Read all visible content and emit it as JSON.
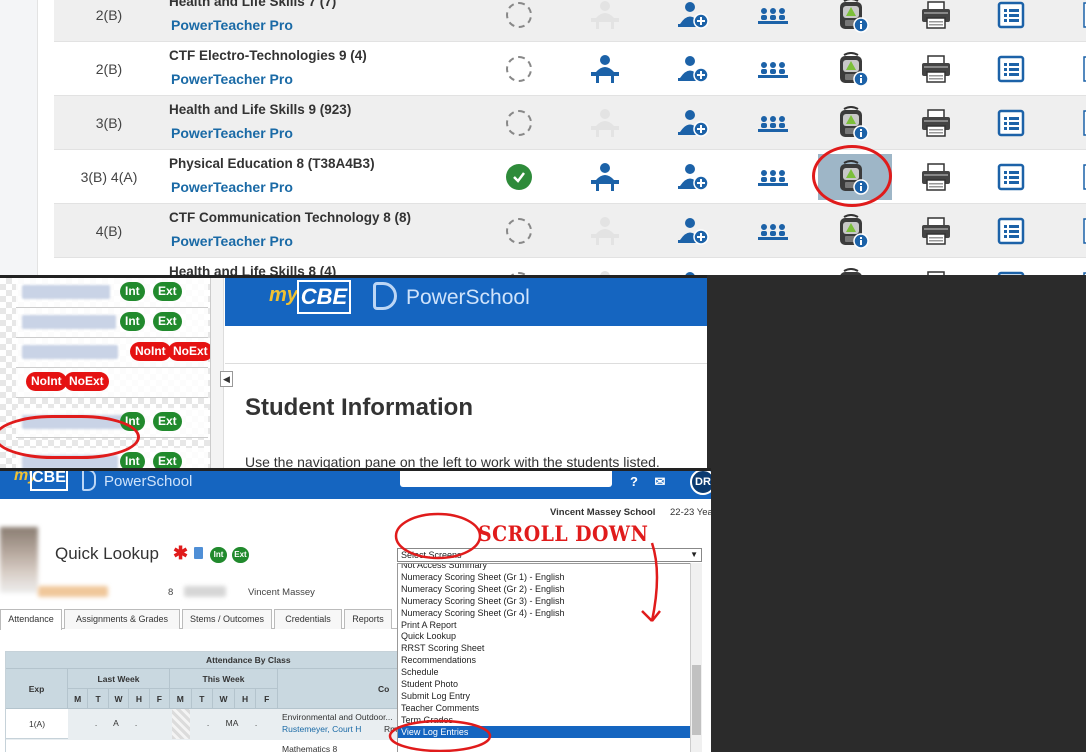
{
  "classes": {
    "rows": [
      {
        "exp": "2(B)",
        "name": "Health and Life Skills 7 (7)",
        "link": "PowerTeacher Pro",
        "attendance": "incomplete",
        "seat": false,
        "shade": true
      },
      {
        "exp": "2(B)",
        "name": "CTF Electro-Technologies 9 (4)",
        "link": "PowerTeacher Pro",
        "attendance": "incomplete",
        "seat": true,
        "shade": false
      },
      {
        "exp": "3(B)",
        "name": "Health and Life Skills 9 (923)",
        "link": "PowerTeacher Pro",
        "attendance": "incomplete",
        "seat": false,
        "shade": true
      },
      {
        "exp": "3(B) 4(A)",
        "name": "Physical Education 8 (T38A4B3)",
        "link": "PowerTeacher Pro",
        "attendance": "complete",
        "seat": true,
        "shade": false,
        "highlight": true
      },
      {
        "exp": "4(B)",
        "name": "CTF Communication Technology 8 (8)",
        "link": "PowerTeacher Pro",
        "attendance": "incomplete",
        "seat": false,
        "shade": true
      },
      {
        "exp": "",
        "name": "Health and Life Skills 8 (4)",
        "link": "",
        "attendance": "incomplete",
        "seat": false,
        "shade": false
      }
    ]
  },
  "student_panel": {
    "brand_my": "my",
    "brand_cbe": "CBE",
    "brand_ps": "PowerSchool",
    "collapse": "◀",
    "heading": "Student Information",
    "help": "Use the navigation pane on the left to work with the students listed.",
    "students": [
      {
        "pills": [
          {
            "label": "Int",
            "color": "g"
          },
          {
            "label": "Ext",
            "color": "g"
          }
        ]
      },
      {
        "pills": [
          {
            "label": "Int",
            "color": "g"
          },
          {
            "label": "Ext",
            "color": "g"
          }
        ]
      },
      {
        "pills": [
          {
            "label": "NoInt",
            "color": "r"
          },
          {
            "label": "NoExt",
            "color": "r"
          }
        ]
      },
      {
        "pills": [
          {
            "label": "NoInt",
            "color": "r"
          },
          {
            "label": "NoExt",
            "color": "r"
          }
        ]
      },
      {
        "pills": [
          {
            "label": "Int",
            "color": "g"
          },
          {
            "label": "Ext",
            "color": "g"
          }
        ]
      },
      {
        "pills": [
          {
            "label": "Int",
            "color": "g"
          },
          {
            "label": "Ext",
            "color": "g"
          }
        ]
      }
    ]
  },
  "quick_lookup": {
    "brand_my": "my",
    "brand_cbe": "CBE",
    "brand_ps": "PowerSchool",
    "help_icon": "?",
    "mail_icon": "✉",
    "avatar": "DR",
    "school": "Vincent Massey School",
    "year": "22-23 Year",
    "title": "Quick Lookup",
    "alert_icon": "✱",
    "pill_int": "Int",
    "pill_ext": "Ext",
    "grade": "8",
    "school_short": "Vincent Massey",
    "tabs": [
      "Attendance",
      "Assignments & Grades",
      "Stems / Outcomes",
      "Credentials",
      "Reports"
    ],
    "grid": {
      "title": "Attendance By Class",
      "col_exp": "Exp",
      "col_last": "Last Week",
      "col_this": "This Week",
      "col_course": "Co",
      "days": [
        "M",
        "T",
        "W",
        "H",
        "F"
      ],
      "row1": {
        "exp": "1(A)",
        "last": [
          ".",
          "A",
          "."
        ],
        "this": [
          ".",
          "MA",
          "."
        ],
        "course": "Environmental and Outdoor...",
        "teacher": "Rustemeyer, Court H",
        "room": "Rm"
      },
      "row2_course": "Mathematics 8"
    },
    "select_label": "Select Screens",
    "dropdown": [
      "Not Access Summary",
      "Numeracy Scoring Sheet (Gr 1) - English",
      "Numeracy Scoring Sheet (Gr 2) - English",
      "Numeracy Scoring Sheet (Gr 3) - English",
      "Numeracy Scoring Sheet (Gr 4) - English",
      "Print A Report",
      "Quick Lookup",
      "RRST Scoring Sheet",
      "Recommendations",
      "Schedule",
      "Student Photo",
      "Submit Log Entry",
      "Teacher Comments",
      "Term Grades",
      "View Log Entries"
    ],
    "annotation": "SCROLL DOWN"
  },
  "colors": {
    "accent": "#1565c0",
    "link": "#1a6aa6",
    "annotation": "#e01b1b",
    "ok": "#218a2d",
    "no": "#e51212"
  }
}
